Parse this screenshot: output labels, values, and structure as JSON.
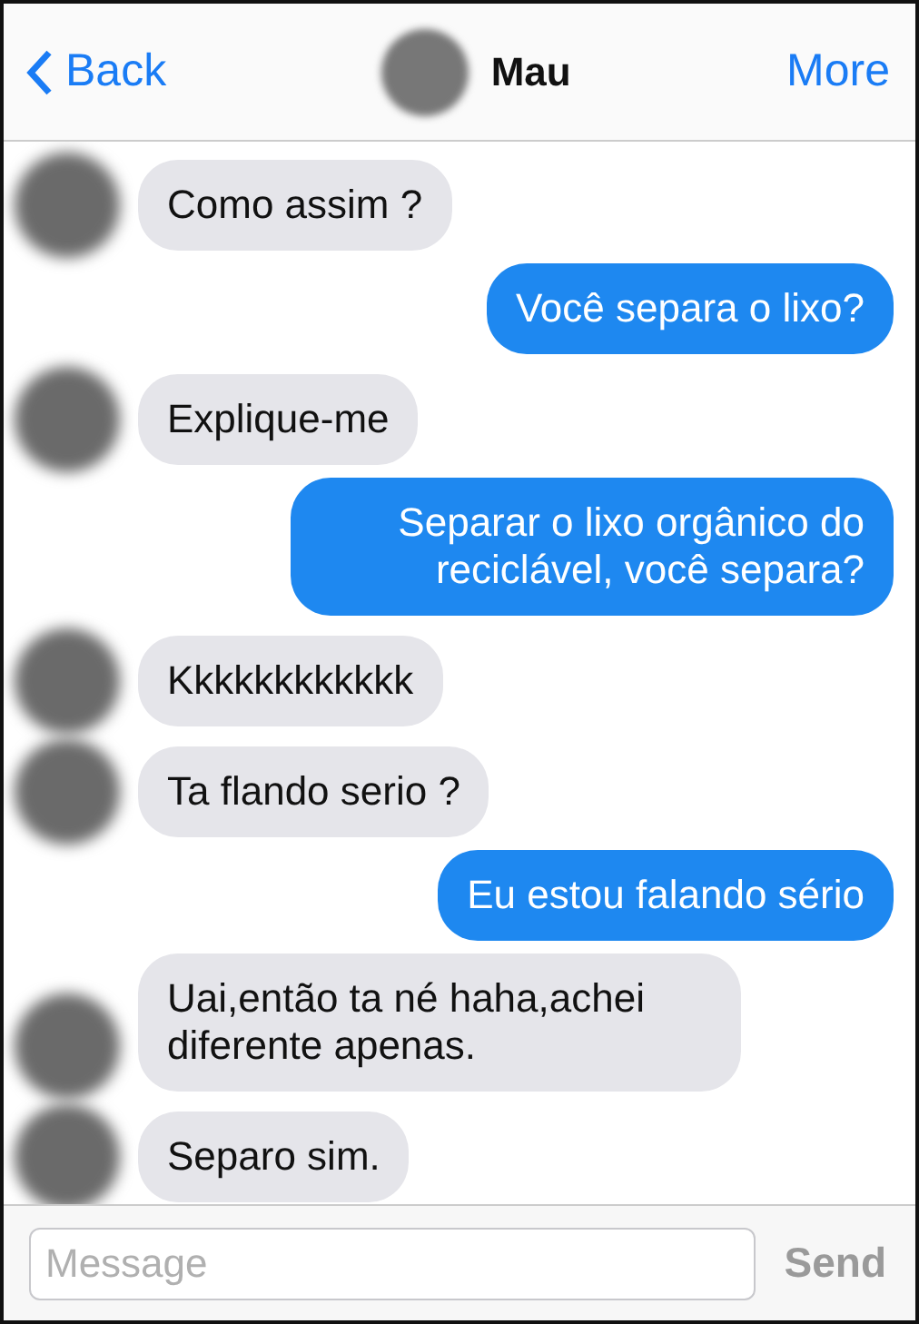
{
  "header": {
    "back_label": "Back",
    "title": "Mau",
    "more_label": "More"
  },
  "messages": [
    {
      "kind": "incoming",
      "text": "Como assim ?"
    },
    {
      "kind": "outgoing",
      "text": "Você separa o lixo?"
    },
    {
      "kind": "incoming",
      "text": "Explique-me"
    },
    {
      "kind": "outgoing",
      "text": "Separar o lixo orgânico do reciclável, você separa?"
    },
    {
      "kind": "incoming",
      "text": "Kkkkkkkkkkkk"
    },
    {
      "kind": "incoming",
      "text": "Ta flando serio ?"
    },
    {
      "kind": "outgoing",
      "text": "Eu estou falando sério"
    },
    {
      "kind": "incoming",
      "text": "Uai,então ta né haha,achei diferente apenas."
    },
    {
      "kind": "incoming",
      "text": "Separo sim."
    }
  ],
  "composer": {
    "placeholder": "Message",
    "send_label": "Send",
    "send_disabled": true
  }
}
